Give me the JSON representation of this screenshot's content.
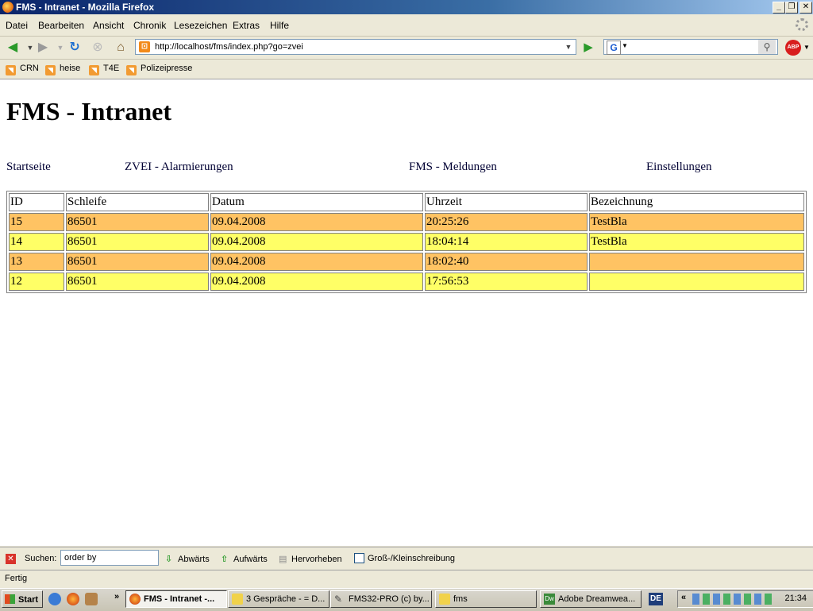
{
  "window": {
    "title": "FMS - Intranet - Mozilla Firefox"
  },
  "menu": {
    "items": [
      "Datei",
      "Bearbeiten",
      "Ansicht",
      "Chronik",
      "Lesezeichen",
      "Extras",
      "Hilfe"
    ]
  },
  "nav": {
    "url": "http://localhost/fms/index.php?go=zvei",
    "search_value": ""
  },
  "bookmarks": [
    "CRN",
    "heise",
    "T4E",
    "Polizeipresse"
  ],
  "page": {
    "heading": "FMS - Intranet",
    "links": [
      "Startseite",
      "ZVEI - Alarmierungen",
      "FMS - Meldungen",
      "Einstellungen"
    ],
    "table": {
      "headers": [
        "ID",
        "Schleife",
        "Datum",
        "Uhrzeit",
        "Bezeichnung"
      ],
      "rows": [
        {
          "id": "15",
          "schleife": "86501",
          "datum": "09.04.2008",
          "uhrzeit": "20:25:26",
          "bezeichnung": "TestBla",
          "color": "#ffc363"
        },
        {
          "id": "14",
          "schleife": "86501",
          "datum": "09.04.2008",
          "uhrzeit": "18:04:14",
          "bezeichnung": "TestBla",
          "color": "#ffff66"
        },
        {
          "id": "13",
          "schleife": "86501",
          "datum": "09.04.2008",
          "uhrzeit": "18:02:40",
          "bezeichnung": "",
          "color": "#ffc363"
        },
        {
          "id": "12",
          "schleife": "86501",
          "datum": "09.04.2008",
          "uhrzeit": "17:56:53",
          "bezeichnung": "",
          "color": "#ffff66"
        }
      ]
    }
  },
  "findbar": {
    "label": "Suchen:",
    "value": "order by",
    "down": "Abwärts",
    "up": "Aufwärts",
    "highlight": "Hervorheben",
    "matchcase": "Groß-/Kleinschreibung"
  },
  "status": {
    "text": "Fertig"
  },
  "taskbar": {
    "start": "Start",
    "tasks": [
      "FMS - Intranet -...",
      "3 Gespräche - = D...",
      "FMS32-PRO (c) by...",
      "fms",
      "Adobe Dreamwea..."
    ],
    "language": "DE",
    "clock": "21:34"
  }
}
